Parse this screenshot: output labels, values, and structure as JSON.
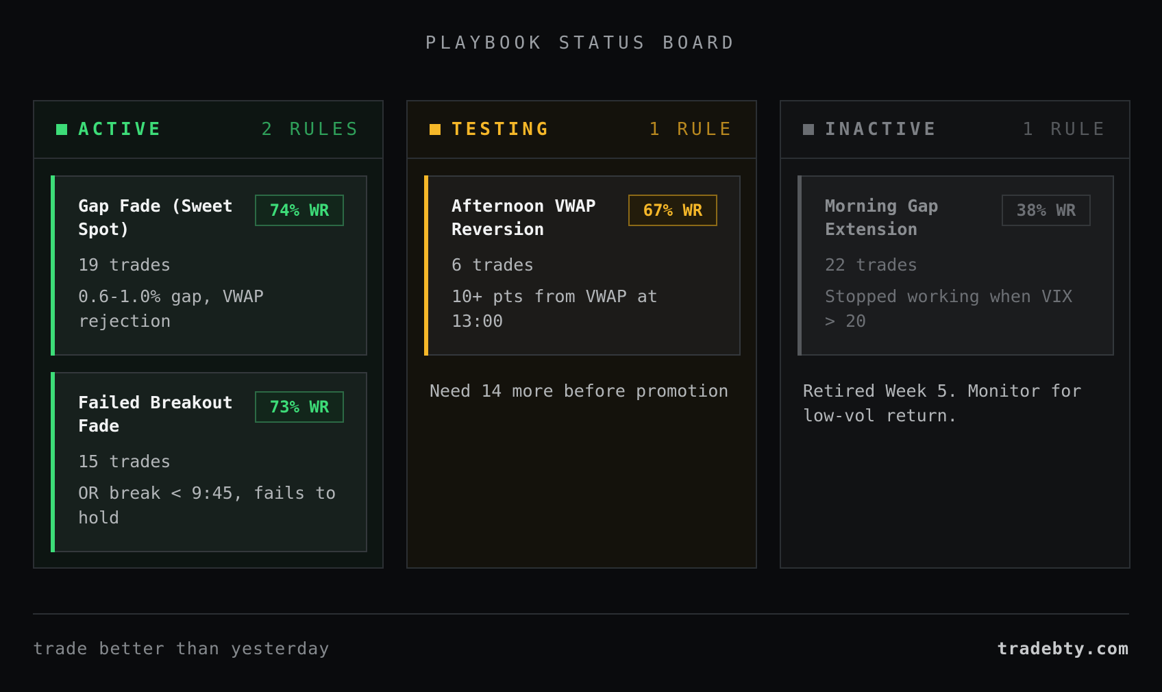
{
  "board": {
    "title": "PLAYBOOK STATUS BOARD"
  },
  "columns": [
    {
      "name": "ACTIVE",
      "count": "2 RULES",
      "cards": [
        {
          "name": "Gap Fade (Sweet Spot)",
          "wr": "74% WR",
          "trades": "19 trades",
          "desc": "0.6-1.0% gap, VWAP rejection"
        },
        {
          "name": "Failed Breakout Fade",
          "wr": "73% WR",
          "trades": "15 trades",
          "desc": "OR break < 9:45, fails to hold"
        }
      ]
    },
    {
      "name": "TESTING",
      "count": "1 RULE",
      "cards": [
        {
          "name": "Afternoon VWAP Reversion",
          "wr": "67% WR",
          "trades": "6 trades",
          "desc": "10+ pts from VWAP at 13:00"
        }
      ],
      "note": "Need 14 more before promotion"
    },
    {
      "name": "INACTIVE",
      "count": "1 RULE",
      "cards": [
        {
          "name": "Morning Gap Extension",
          "wr": "38% WR",
          "trades": "22 trades",
          "desc": "Stopped working when VIX > 20"
        }
      ],
      "note": "Retired Week 5. Monitor for low-vol return."
    }
  ],
  "footer": {
    "tagline": "trade better than yesterday",
    "site": "tradebty.com"
  },
  "colors": {
    "active": "#3ddc78",
    "testing": "#f5b729",
    "inactive": "#6a6d72",
    "background": "#0a0b0d"
  }
}
